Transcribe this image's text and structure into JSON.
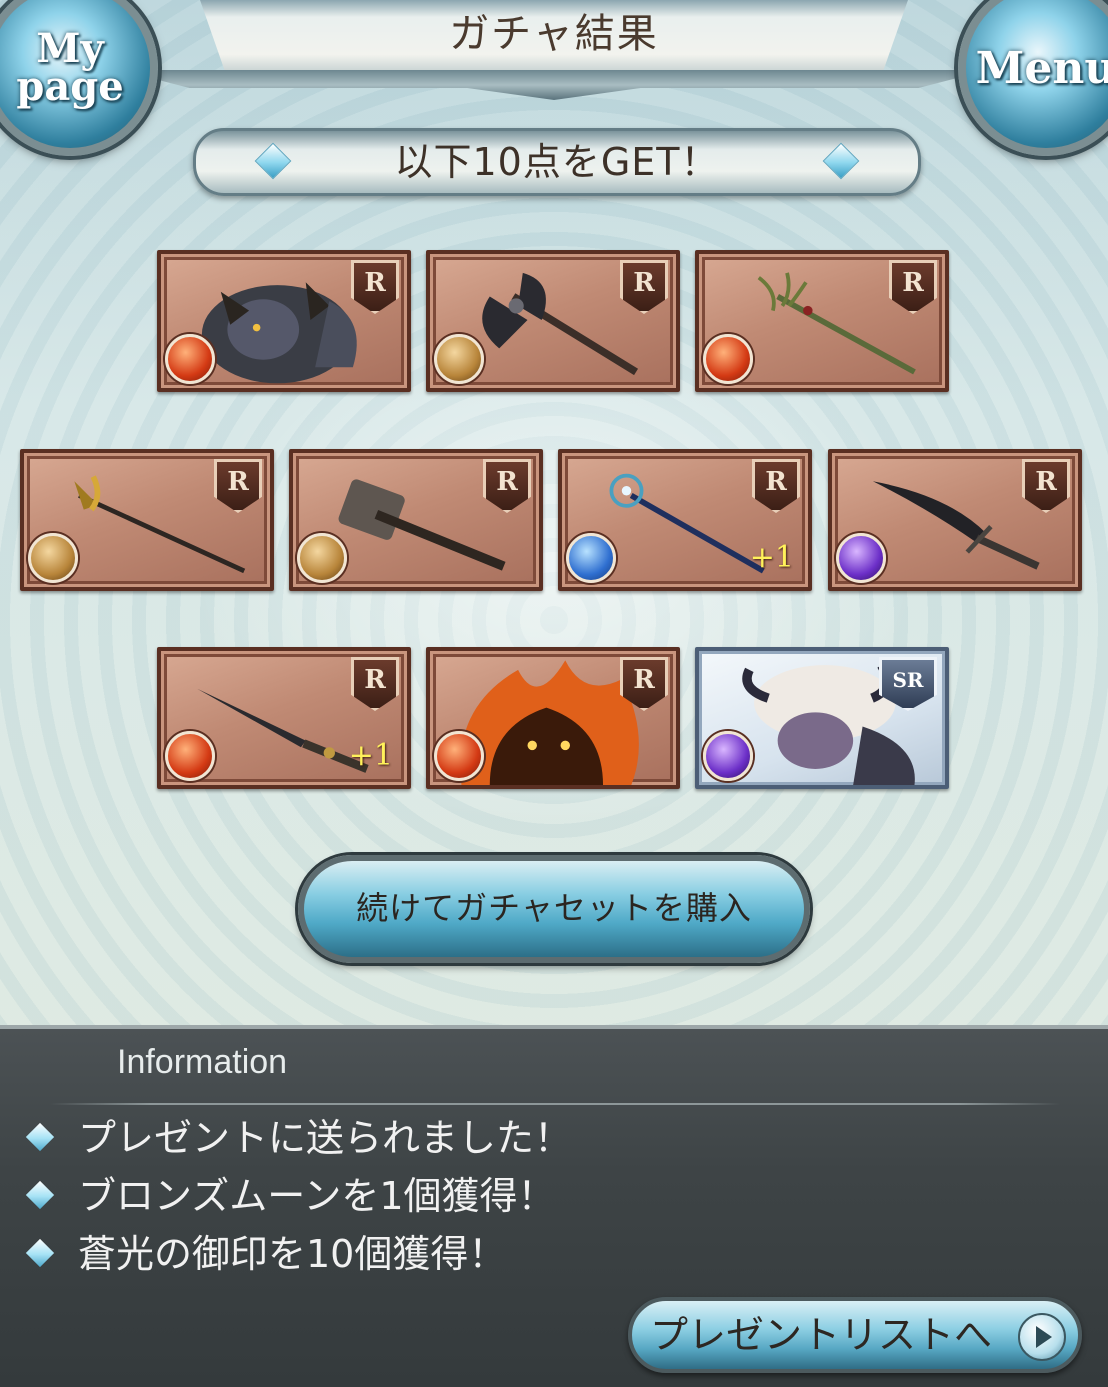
{
  "header": {
    "title": "ガチャ結果",
    "mypage_label_1": "My",
    "mypage_label_2": "page",
    "menu_label": "Menu"
  },
  "banner": {
    "text": "以下10点をGET！"
  },
  "items": [
    {
      "rarity": "R",
      "element": "fire",
      "kind": "character-werewolf",
      "plus": ""
    },
    {
      "rarity": "R",
      "element": "earth",
      "kind": "weapon-axe",
      "plus": ""
    },
    {
      "rarity": "R",
      "element": "fire",
      "kind": "weapon-staff",
      "plus": ""
    },
    {
      "rarity": "R",
      "element": "earth",
      "kind": "weapon-spear",
      "plus": ""
    },
    {
      "rarity": "R",
      "element": "earth",
      "kind": "weapon-hammer",
      "plus": ""
    },
    {
      "rarity": "R",
      "element": "water",
      "kind": "weapon-scepter",
      "plus": "+1"
    },
    {
      "rarity": "R",
      "element": "dark",
      "kind": "weapon-sword",
      "plus": ""
    },
    {
      "rarity": "R",
      "element": "fire",
      "kind": "weapon-dagger",
      "plus": "+1"
    },
    {
      "rarity": "R",
      "element": "fire",
      "kind": "summon-fire-spirit",
      "plus": ""
    },
    {
      "rarity": "SR",
      "element": "dark",
      "kind": "character-horned",
      "plus": ""
    }
  ],
  "buy_button": {
    "label": "続けてガチャセットを購入"
  },
  "information": {
    "title": "Information",
    "lines": [
      "プレゼントに送られました！",
      "ブロンズムーンを1個獲得！",
      "蒼光の御印を10個獲得！"
    ]
  },
  "present_button": {
    "label": "プレゼントリストへ"
  },
  "colors": {
    "fire": "#d43a14",
    "earth": "#b8853a",
    "water": "#2f6fd0",
    "dark": "#6c2fc8",
    "card_bronze": "#c08a74",
    "info_panel": "#3e4446"
  }
}
